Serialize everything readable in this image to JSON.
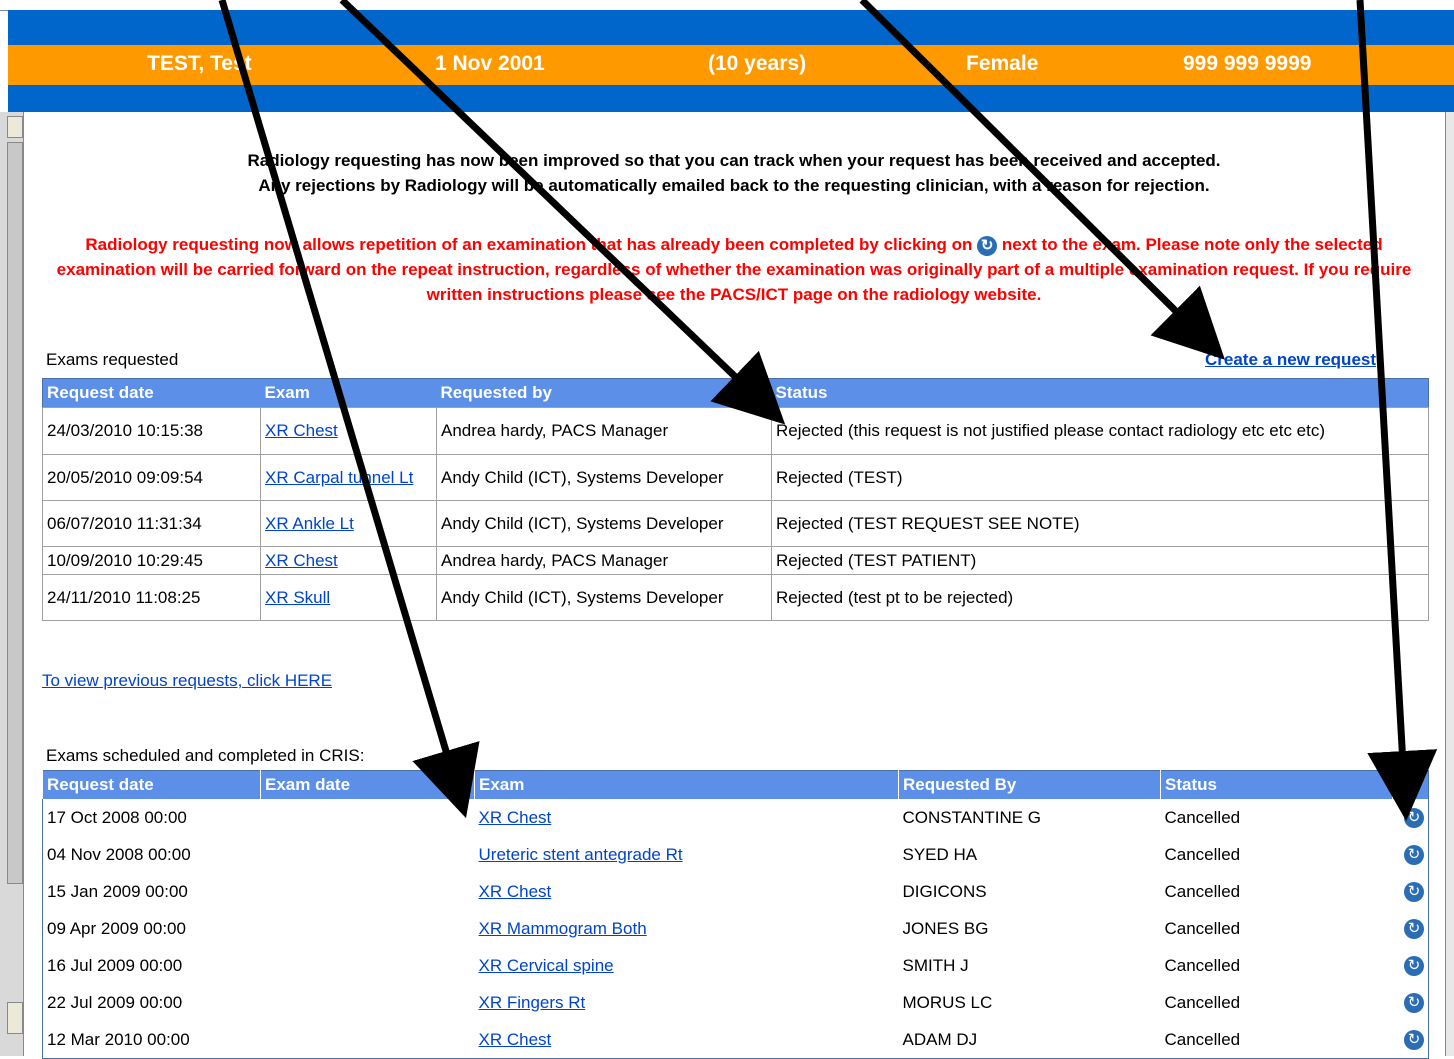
{
  "patient": {
    "name": "TEST, Test",
    "dob": "1 Nov 2001",
    "age": "(10 years)",
    "sex": "Female",
    "nhs_number": "999 999 9999"
  },
  "notice": {
    "line1": "Radiology requesting has now been improved so that you can track when your request has been received and accepted.",
    "line2": "Any rejections by Radiology will be automatically emailed back to the requesting clinician, with a reason for rejection.",
    "red_part1": "Radiology requesting now allows repetition of an examination that has already been completed by clicking on",
    "red_part2": "next to the exam. Please note only the selected examination will be carried forward on the repeat instruction, regardless of whether the examination was originally part of a multiple examination request. If you require written instructions please see the PACS/ICT page on the radiology website.",
    "icon": "refresh-icon"
  },
  "requested": {
    "caption": "Exams requested",
    "create_link": "Create a new request",
    "headers": [
      "Request date",
      "Exam",
      "Requested by",
      "Status"
    ],
    "rows": [
      {
        "date": "24/03/2010 10:15:38",
        "exam": "XR Chest",
        "by": "Andrea hardy, PACS Manager",
        "status": "Rejected (this request is not justified please contact radiology etc etc etc)"
      },
      {
        "date": "20/05/2010 09:09:54",
        "exam": "XR Carpal tunnel Lt",
        "by": "Andy Child (ICT), Systems Developer",
        "status": "Rejected (TEST)"
      },
      {
        "date": "06/07/2010 11:31:34",
        "exam": "XR Ankle Lt",
        "by": "Andy Child (ICT), Systems Developer",
        "status": "Rejected (TEST REQUEST SEE NOTE)"
      },
      {
        "date": "10/09/2010 10:29:45",
        "exam": "XR Chest",
        "by": "Andrea hardy, PACS Manager",
        "status": "Rejected (TEST PATIENT)"
      },
      {
        "date": "24/11/2010 11:08:25",
        "exam": "XR Skull",
        "by": "Andy Child (ICT), Systems Developer",
        "status": "Rejected (test pt to be rejected)"
      }
    ],
    "previous_link": "To view previous requests, click HERE"
  },
  "scheduled": {
    "caption": "Exams scheduled and completed in CRIS:",
    "headers": [
      "Request date",
      "Exam date",
      "Exam",
      "Requested By",
      "Status",
      ""
    ],
    "rows": [
      {
        "req": "17 Oct 2008 00:00",
        "exam_date": "",
        "exam": "XR Chest",
        "by": "CONSTANTINE G",
        "status": "Cancelled"
      },
      {
        "req": "04 Nov 2008 00:00",
        "exam_date": "",
        "exam": "Ureteric stent antegrade Rt",
        "by": "SYED HA",
        "status": "Cancelled"
      },
      {
        "req": "15 Jan 2009 00:00",
        "exam_date": "",
        "exam": "XR Chest",
        "by": "DIGICONS",
        "status": "Cancelled"
      },
      {
        "req": "09 Apr 2009 00:00",
        "exam_date": "",
        "exam": "XR Mammogram Both",
        "by": "JONES BG",
        "status": "Cancelled"
      },
      {
        "req": "16 Jul 2009 00:00",
        "exam_date": "",
        "exam": "XR Cervical spine",
        "by": "SMITH J",
        "status": "Cancelled"
      },
      {
        "req": "22 Jul 2009 00:00",
        "exam_date": "",
        "exam": "XR Fingers Rt",
        "by": "MORUS LC",
        "status": "Cancelled"
      },
      {
        "req": "12 Mar 2010 00:00",
        "exam_date": "",
        "exam": "XR Chest",
        "by": "ADAM DJ",
        "status": "Cancelled"
      }
    ]
  },
  "colors": {
    "banner_orange": "#ff9900",
    "banner_blue": "#0066cc",
    "header_blue": "#5b8fe8",
    "notice_red": "#ff0000",
    "link_blue": "#0044cc"
  }
}
